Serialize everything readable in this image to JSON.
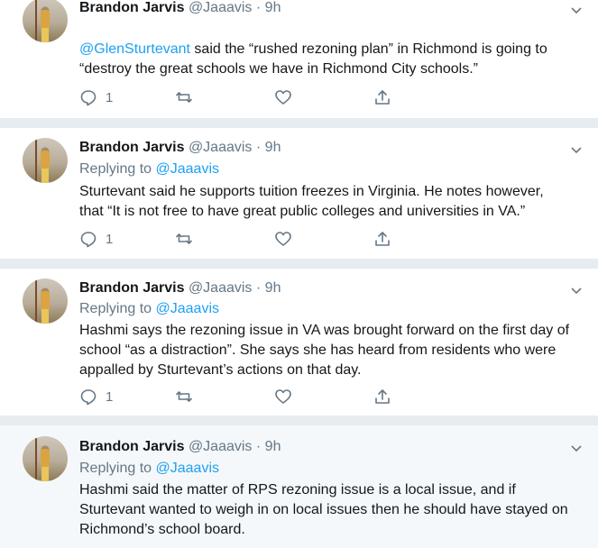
{
  "tweets": [
    {
      "name": "Brandon Jarvis",
      "handle": "@Jaaavis",
      "dot": "·",
      "time": "9h",
      "replying_prefix": "",
      "replying_to": "",
      "text_mention": "@GlenSturtevant",
      "text_line1_rest": " said the “rushed rezoning plan” in Richmond is going to",
      "text_line2": "“destroy the great schools we have in Richmond City schools.”",
      "text_line3": "",
      "reply_count": "1"
    },
    {
      "name": "Brandon Jarvis",
      "handle": "@Jaaavis",
      "dot": "·",
      "time": "9h",
      "replying_prefix": "Replying to ",
      "replying_to": "@Jaaavis",
      "text_line1": "Sturtevant said he supports tuition freezes in Virginia. He notes however,",
      "text_line2": "that “It is not free to have great public colleges and universities in VA.”",
      "reply_count": "1"
    },
    {
      "name": "Brandon Jarvis",
      "handle": "@Jaaavis",
      "dot": "·",
      "time": "9h",
      "replying_prefix": "Replying to ",
      "replying_to": "@Jaaavis",
      "text_line1": "Hashmi says the rezoning issue in VA was brought forward on the first day of",
      "text_line2": "school “as a distraction”. She says she has heard from residents who were",
      "text_line3": "appalled by Sturtevant’s actions on that day.",
      "reply_count": "1"
    },
    {
      "name": "Brandon Jarvis",
      "handle": "@Jaaavis",
      "dot": "·",
      "time": "9h",
      "replying_prefix": "Replying to ",
      "replying_to": "@Jaaavis",
      "text_line1": "Hashmi said the matter of RPS rezoning issue is a local issue, and if",
      "text_line2": "Sturtevant wanted to weigh in on local issues then he should have stayed on",
      "text_line3": "Richmond’s school board."
    }
  ],
  "icons": {
    "reply": "reply-icon",
    "retweet": "retweet-icon",
    "like": "heart-icon",
    "share": "share-icon",
    "menu": "chevron-down-icon"
  },
  "colors": {
    "link": "#1da1f2",
    "muted": "#657786",
    "separator": "#e6ecf0",
    "highlight": "#f5f8fa"
  }
}
